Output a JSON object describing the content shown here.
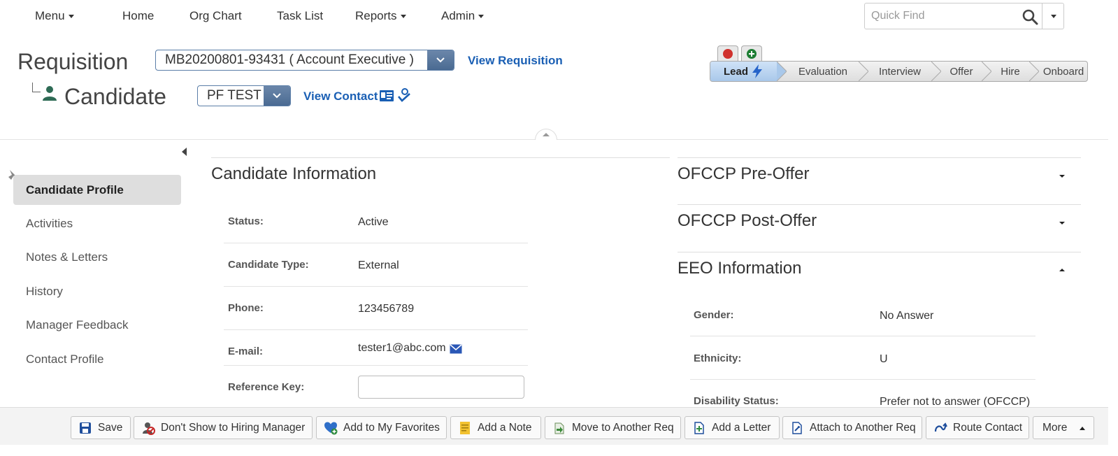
{
  "nav": {
    "menu": "Menu",
    "home": "Home",
    "org_chart": "Org Chart",
    "task_list": "Task List",
    "reports": "Reports",
    "admin": "Admin",
    "quick_find_placeholder": "Quick Find"
  },
  "header": {
    "requisition_label": "Requisition",
    "candidate_label": "Candidate",
    "requisition_value": "MB20200801-93431 ( Account Executive )",
    "view_requisition": "View Requisition",
    "candidate_value": "PF TEST",
    "view_contact": "View Contact"
  },
  "pipeline": {
    "stages": [
      "Lead",
      "Evaluation",
      "Interview",
      "Offer",
      "Hire",
      "Onboard"
    ],
    "active_stage": "Lead",
    "colors": {
      "active": "#a9c8ea",
      "red_dot": "#d0312d",
      "green_plus": "#1e7e34"
    }
  },
  "sidebar": {
    "items": [
      "Candidate Profile",
      "Activities",
      "Notes & Letters",
      "History",
      "Manager Feedback",
      "Contact Profile"
    ],
    "active": "Candidate Profile"
  },
  "candidate_info": {
    "title": "Candidate Information",
    "fields": [
      {
        "label": "Status:",
        "value": "Active"
      },
      {
        "label": "Candidate Type:",
        "value": "External"
      },
      {
        "label": "Phone:",
        "value": "123456789"
      },
      {
        "label": "E-mail:",
        "value": "tester1@abc.com"
      },
      {
        "label": "Reference Key:",
        "value": ""
      }
    ]
  },
  "right_sections": {
    "ofccp_pre": "OFCCP Pre-Offer",
    "ofccp_post": "OFCCP Post-Offer",
    "eeo": {
      "title": "EEO Information",
      "fields": [
        {
          "label": "Gender:",
          "value": "No Answer"
        },
        {
          "label": "Ethnicity:",
          "value": "U"
        },
        {
          "label": "Disability Status:",
          "value": "Prefer not to answer (OFCCP)"
        }
      ]
    }
  },
  "toolbar": {
    "save": "Save",
    "dont_show": "Don't Show to Hiring Manager",
    "add_favorites": "Add to My Favorites",
    "add_note": "Add a Note",
    "move_req": "Move to Another Req",
    "add_letter": "Add a Letter",
    "attach_req": "Attach to Another Req",
    "route_contact": "Route Contact",
    "more": "More"
  },
  "colors": {
    "link": "#1a5fb4",
    "select_button": "#4a6a92",
    "sidebar_active": "#dedede"
  }
}
